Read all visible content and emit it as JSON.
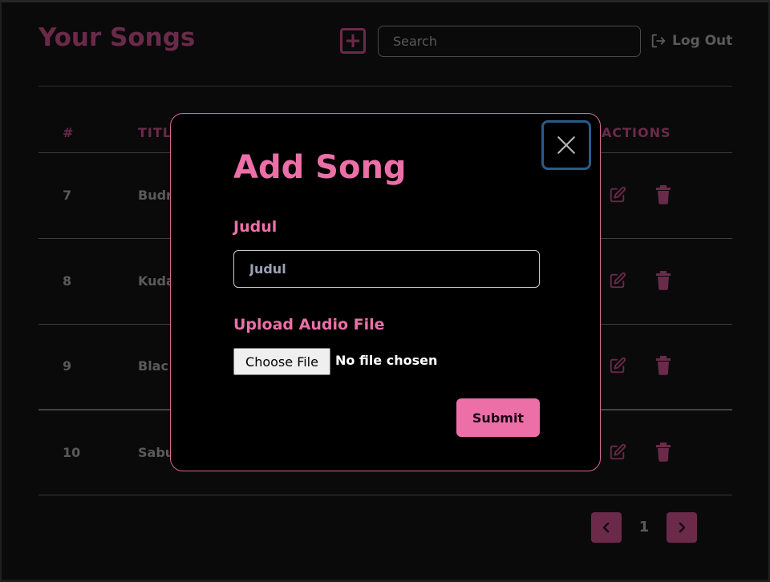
{
  "header": {
    "title": "Your Songs",
    "add_icon": "plus-square-icon",
    "search_placeholder": "Search",
    "logout_label": "Log Out",
    "logout_icon": "logout-icon"
  },
  "table": {
    "columns": {
      "number": "#",
      "title": "TITL",
      "actions": "ACTIONS"
    },
    "rows": [
      {
        "number": "7",
        "title": "Budr"
      },
      {
        "number": "8",
        "title": "Kuda"
      },
      {
        "number": "9",
        "title": "Blac"
      },
      {
        "number": "10",
        "title": "Sabu"
      }
    ],
    "edit_icon": "edit-icon",
    "delete_icon": "trash-icon"
  },
  "pagination": {
    "current_page": "1",
    "prev_icon": "chevron-left-icon",
    "next_icon": "chevron-right-icon"
  },
  "modal": {
    "title": "Add Song",
    "close_icon": "close-icon",
    "title_field_label": "Judul",
    "title_field_value": "Judul",
    "upload_label": "Upload Audio File",
    "choose_file_label": "Choose File",
    "file_status": "No file chosen",
    "submit_label": "Submit"
  },
  "colors": {
    "accent": "#ec6fa8",
    "accent_dim": "#6b2a4a",
    "background": "#0a0a0a",
    "focus_ring": "#2c5a86"
  }
}
